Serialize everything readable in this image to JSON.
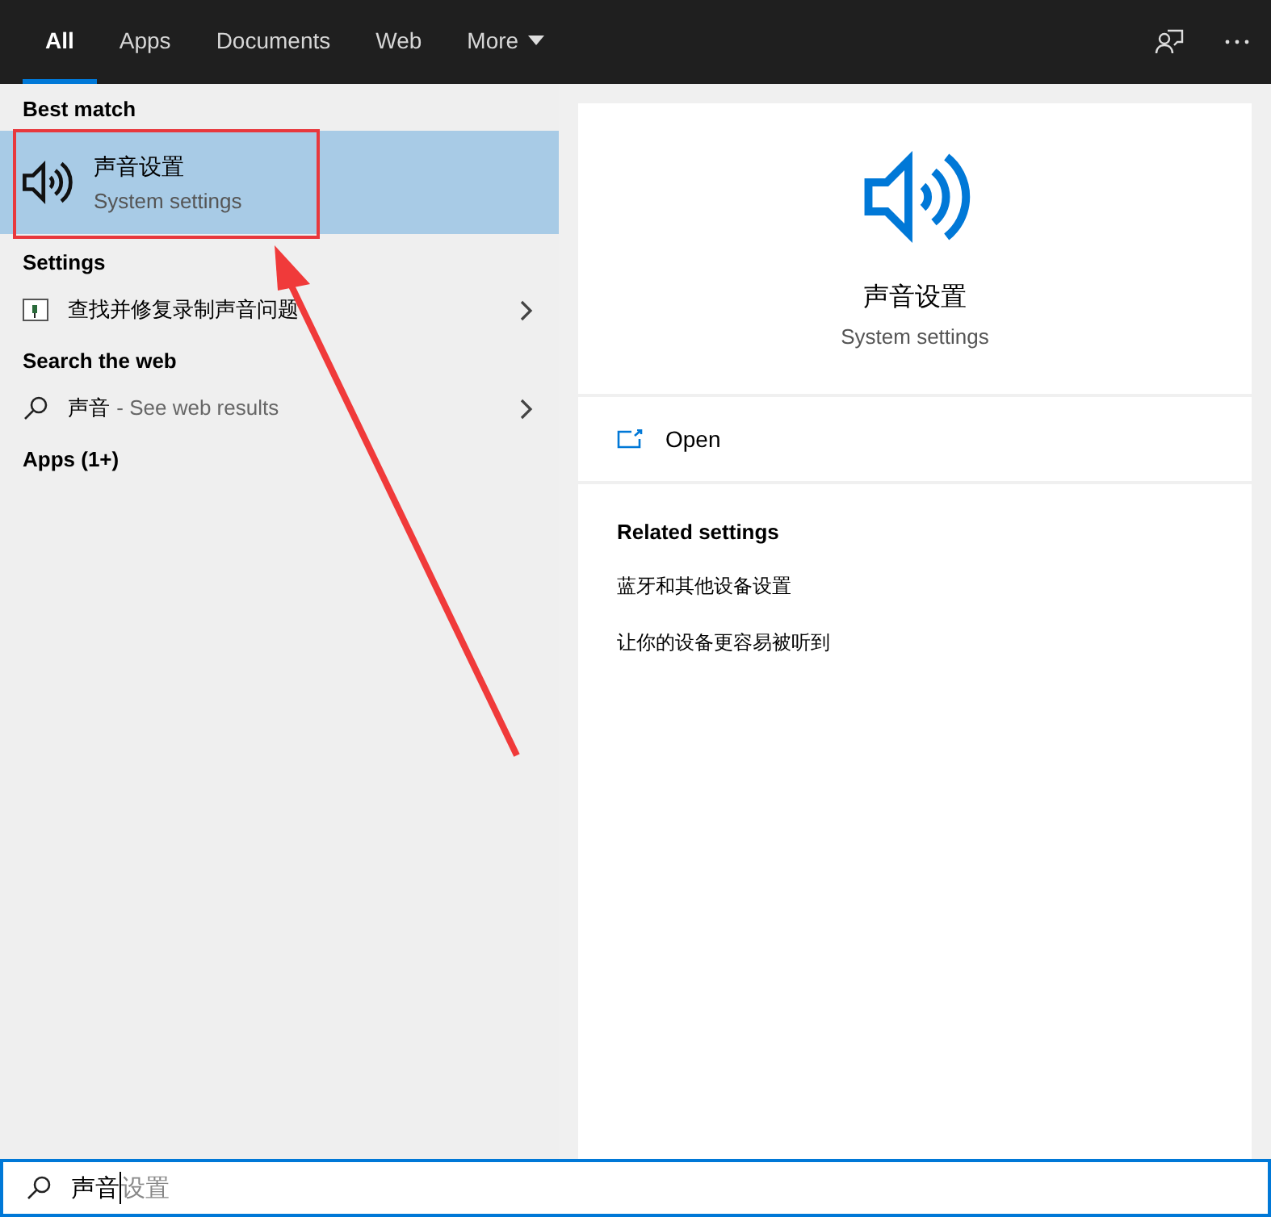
{
  "tabs": [
    {
      "label": "All",
      "selected": true
    },
    {
      "label": "Apps",
      "selected": false
    },
    {
      "label": "Documents",
      "selected": false
    },
    {
      "label": "Web",
      "selected": false
    },
    {
      "label": "More",
      "selected": false,
      "kind": "dropdown"
    }
  ],
  "results": [
    {
      "kind": "heading",
      "text": "Best match"
    },
    {
      "kind": "best",
      "title": "声音设置",
      "subtitle": "System settings",
      "selected": true
    },
    {
      "kind": "heading",
      "text": "Settings"
    },
    {
      "kind": "setting",
      "title": "查找并修复录制声音问题"
    },
    {
      "kind": "heading",
      "text": "Search the web"
    },
    {
      "kind": "web",
      "title": "声音",
      "suffix": "- See web results"
    },
    {
      "kind": "heading",
      "text": "Apps (1+)"
    }
  ],
  "preview": {
    "title": "声音设置",
    "subtitle": "System settings",
    "action": "Open",
    "related_heading": "Related settings",
    "related": [
      "蓝牙和其他设备设置",
      "让你的设备更容易被听到"
    ]
  },
  "search": {
    "value": "声音",
    "completion": "设置"
  }
}
